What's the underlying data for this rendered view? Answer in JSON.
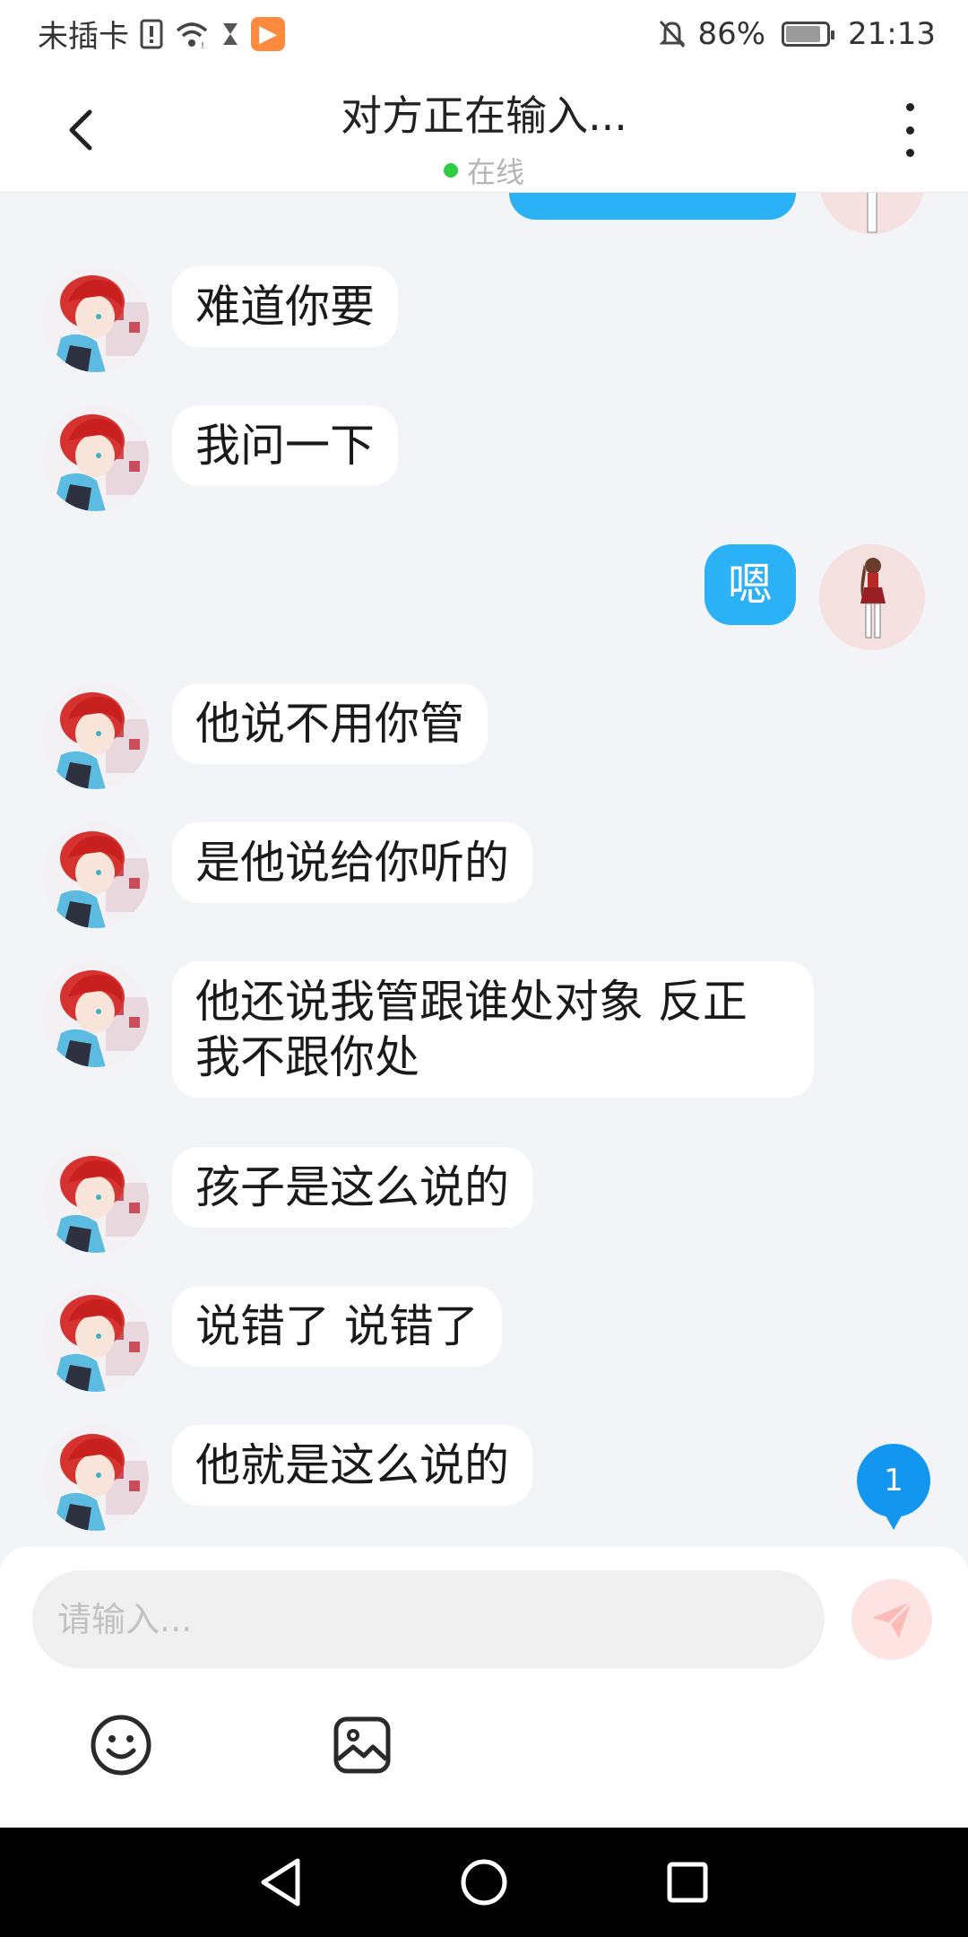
{
  "status_bar": {
    "carrier": "未插卡",
    "battery_level": "86%",
    "battery_fraction": 0.86,
    "time": "21:13",
    "icons": [
      "sim-alert-icon",
      "wifi-icon",
      "hourglass-icon",
      "app-notification-icon",
      "mute-bell-icon",
      "battery-icon"
    ]
  },
  "header": {
    "title": "对方正在输入...",
    "status": "在线",
    "status_color": "#2ecc40"
  },
  "messages": [
    {
      "sender": "peer",
      "text": "难道你要"
    },
    {
      "sender": "peer",
      "text": "我问一下"
    },
    {
      "sender": "me",
      "text": "嗯"
    },
    {
      "sender": "peer",
      "text": "他说不用你管"
    },
    {
      "sender": "peer",
      "text": "是他说给你听的"
    },
    {
      "sender": "peer",
      "text": "他还说我管跟谁处对象 反正我不跟你处"
    },
    {
      "sender": "peer",
      "text": "孩子是这么说的"
    },
    {
      "sender": "peer",
      "text": "说错了 说错了"
    },
    {
      "sender": "peer",
      "text": "他就是这么说的"
    }
  ],
  "unread_count": "1",
  "input": {
    "placeholder": "请输入..."
  },
  "colors": {
    "my_bubble": "#2bb1f5",
    "peer_bubble": "#ffffff",
    "background": "#f2f4f7",
    "unread_badge": "#1296ef"
  }
}
